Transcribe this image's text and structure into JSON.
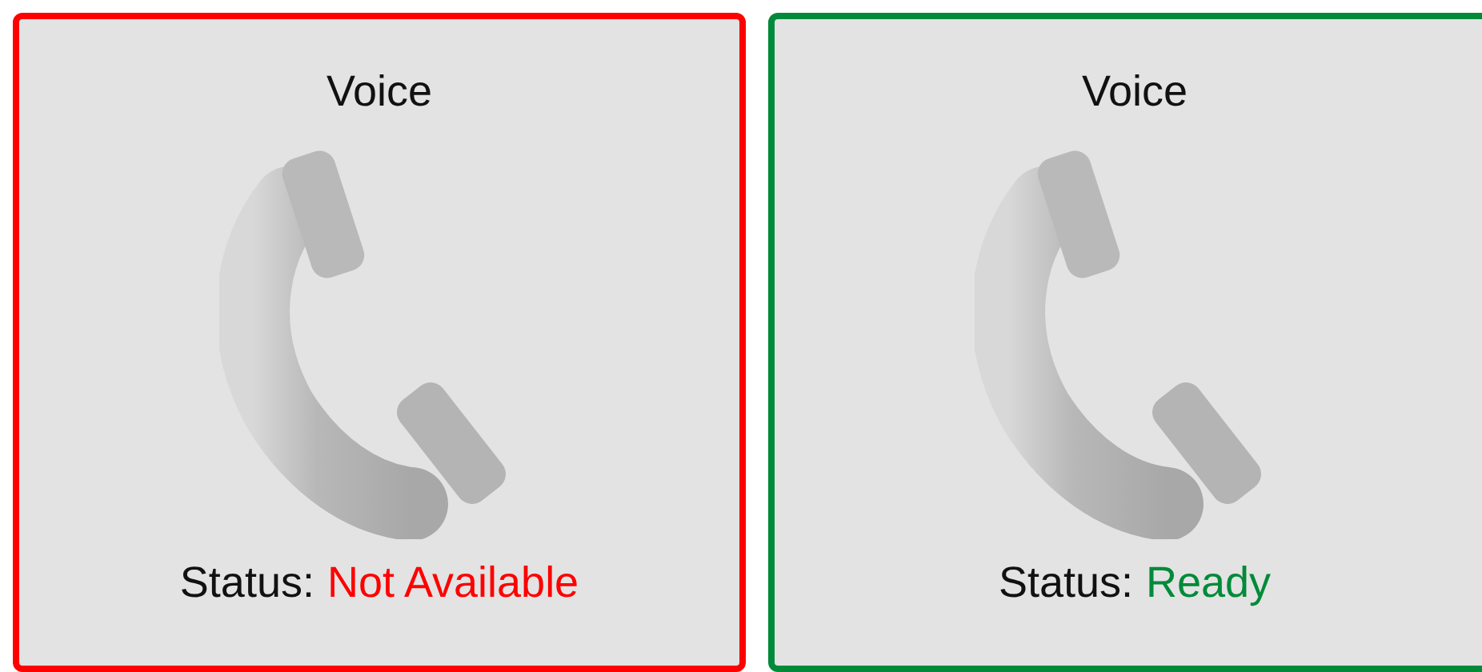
{
  "cards": [
    {
      "title": "Voice",
      "status_label": "Status:",
      "status_value": "Not Available",
      "color": "#ff0000"
    },
    {
      "title": "Voice",
      "status_label": "Status:",
      "status_value": "Ready",
      "color": "#008a3a"
    }
  ]
}
